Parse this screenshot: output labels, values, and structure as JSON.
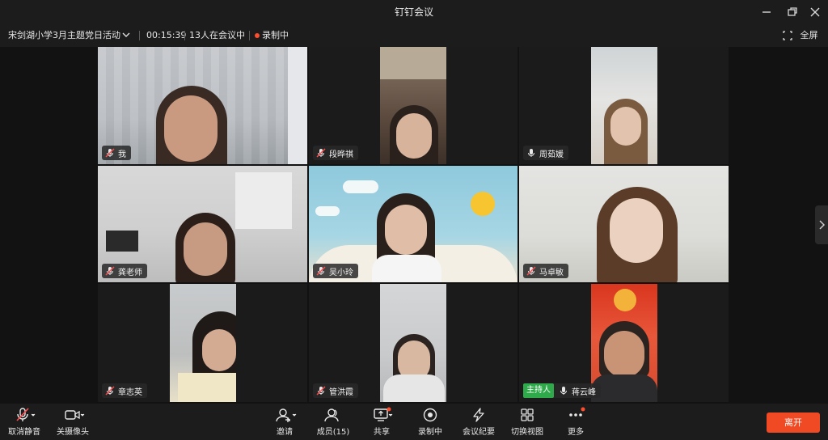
{
  "window": {
    "title": "钉钉会议"
  },
  "info_bar": {
    "meeting_name": "宋剑湖小学3月主题党日活动",
    "duration": "00:15:39",
    "participants_text": "13人在会议中",
    "recording_text": "录制中",
    "fullscreen_label": "全屏"
  },
  "participants": [
    {
      "name": "我",
      "mic": "muted"
    },
    {
      "name": "段晔祺",
      "mic": "muted"
    },
    {
      "name": "周茹媛",
      "mic": "on"
    },
    {
      "name": "龚老师",
      "mic": "muted"
    },
    {
      "name": "吴小玲",
      "mic": "muted"
    },
    {
      "name": "马卓敏",
      "mic": "muted"
    },
    {
      "name": "章志英",
      "mic": "muted"
    },
    {
      "name": "管洪霞",
      "mic": "muted"
    },
    {
      "name": "蒋云峰",
      "mic": "on",
      "badge": "主持人"
    }
  ],
  "toolbar": {
    "unmute": "取消静音",
    "camera_off": "关摄像头",
    "invite": "邀请",
    "members": "成员(15)",
    "share": "共享",
    "record": "录制中",
    "minutes": "会议纪要",
    "switch_view": "切换视图",
    "more": "更多",
    "leave": "离开"
  },
  "colors": {
    "accent_leave": "#f04a24",
    "host_badge": "#2eaa4a",
    "record_dot": "#ff4d2d"
  }
}
